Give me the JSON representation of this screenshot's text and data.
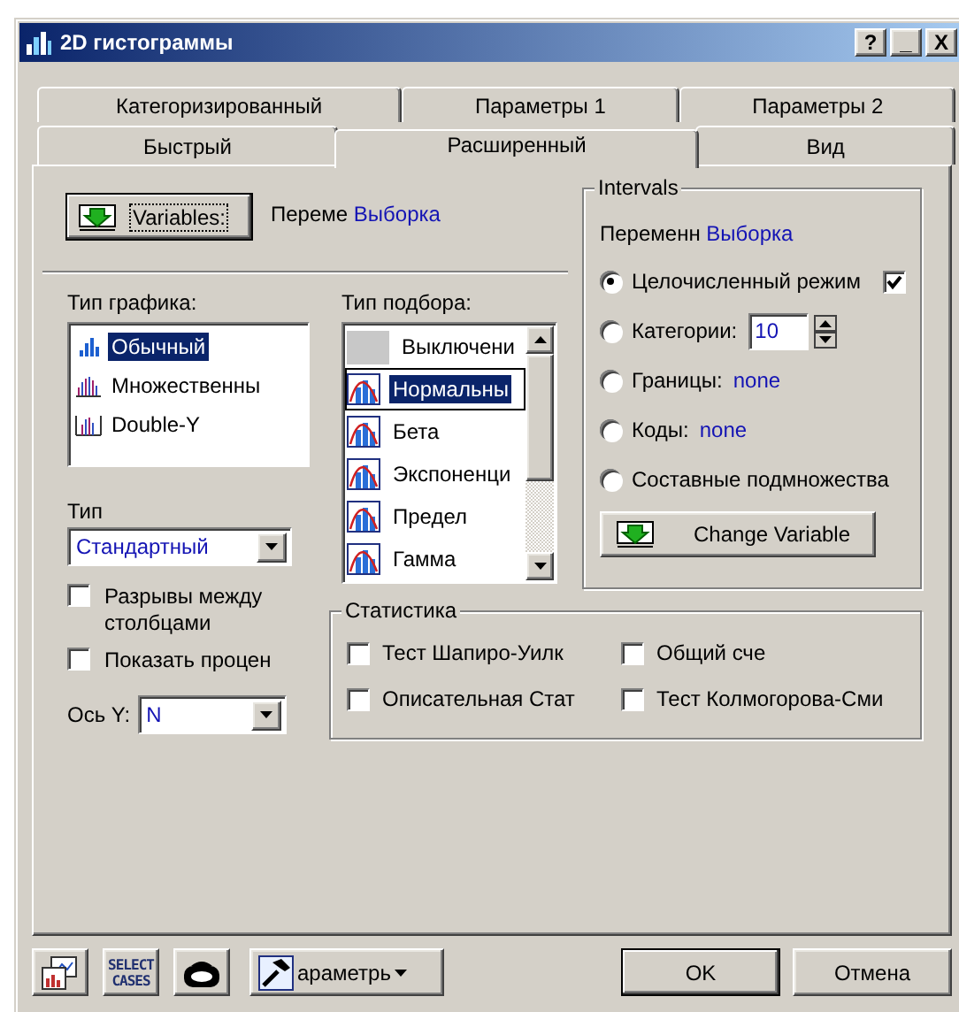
{
  "window": {
    "title": "2D гистограммы",
    "title_buttons": [
      "?",
      "_",
      "X"
    ]
  },
  "tab_rows": [
    {
      "tabs": [
        {
          "label": "Категоризированный",
          "selected": false
        },
        {
          "label": "Параметры 1",
          "selected": false
        },
        {
          "label": "Параметры 2",
          "selected": false
        }
      ]
    },
    {
      "tabs": [
        {
          "label": "Быстрый",
          "selected": false
        },
        {
          "label": "Расширенный",
          "selected": true
        },
        {
          "label": "Вид",
          "selected": false
        }
      ]
    }
  ],
  "variables": {
    "button": "Variables:",
    "label": "Переме",
    "value": "Выборка"
  },
  "graph_type": {
    "label": "Тип графика:",
    "items": [
      {
        "label": "Обычный",
        "kind": "single",
        "selected": true
      },
      {
        "label": "Множественны",
        "kind": "multiple",
        "selected": false
      },
      {
        "label": "Double-Y",
        "kind": "double",
        "selected": false
      }
    ]
  },
  "fit_type": {
    "label": "Тип подбора:",
    "items": [
      {
        "label": "Выключени",
        "kind": "off",
        "selected": false
      },
      {
        "label": "Нормальны",
        "kind": "fit",
        "selected": true
      },
      {
        "label": "Бета",
        "kind": "fit",
        "selected": false
      },
      {
        "label": "Экспоненци",
        "kind": "fit",
        "selected": false
      },
      {
        "label": "Предел",
        "kind": "fit",
        "selected": false
      },
      {
        "label": "Гамма",
        "kind": "fit",
        "selected": false
      }
    ]
  },
  "type": {
    "label": "Тип",
    "value": "Стандартный"
  },
  "options": [
    {
      "label": "Разрывы между столбцами",
      "checked": false
    },
    {
      "label": "Показать процен",
      "checked": false
    }
  ],
  "y_axis": {
    "label": "Ось Y:",
    "value": "N"
  },
  "intervals": {
    "title": "Intervals",
    "variable_label": "Переменн",
    "variable_value": "Выборка",
    "options": [
      {
        "label": "Целочисленный режим",
        "kind": "check",
        "selected": true,
        "checked": true
      },
      {
        "label": "Категории:",
        "kind": "spin",
        "selected": false,
        "value": "10"
      },
      {
        "label": "Границы:",
        "kind": "value",
        "selected": false,
        "value": "none"
      },
      {
        "label": "Коды:",
        "kind": "value",
        "selected": false,
        "value": "none"
      },
      {
        "label": "Составные подмножества",
        "kind": "plain",
        "selected": false
      }
    ],
    "button": "Change Variable"
  },
  "statistics": {
    "title": "Статистика",
    "items": [
      {
        "label": "Тест Шапиро-Уилк",
        "checked": false
      },
      {
        "label": "Общий сче",
        "checked": false
      },
      {
        "label": "Описательная Стат",
        "checked": false
      },
      {
        "label": "Тест Колмогорова-Сми",
        "checked": false
      }
    ]
  },
  "footer": {
    "tools": [
      {
        "kind": "graph"
      },
      {
        "kind": "select",
        "label": "SELECT CASES"
      },
      {
        "kind": "io"
      }
    ],
    "options_button": "араметрь",
    "ok": "OK",
    "cancel": "Отмена"
  }
}
